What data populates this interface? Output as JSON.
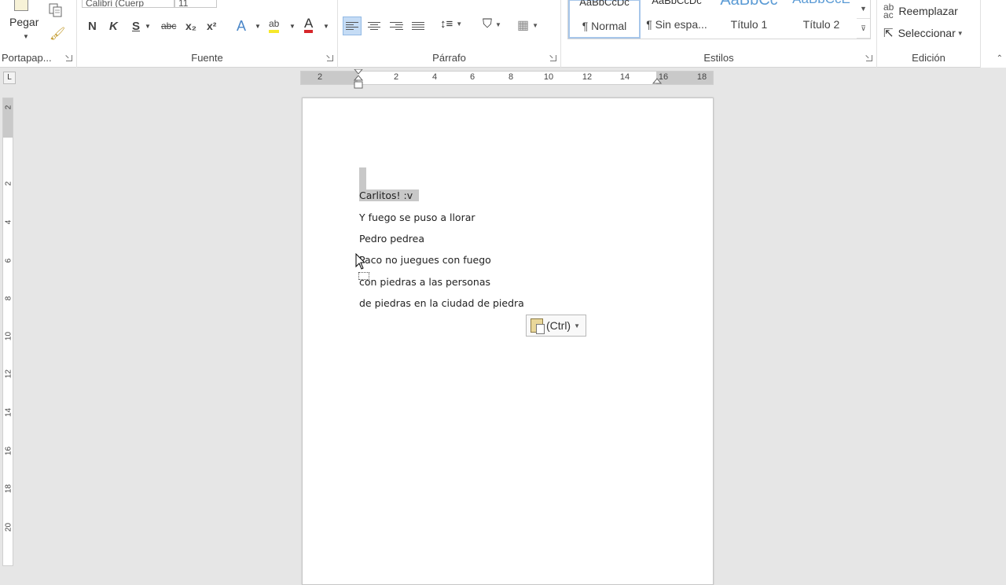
{
  "ribbon": {
    "clipboard": {
      "paste_label": "Pegar",
      "group_label": "Portapap..."
    },
    "font": {
      "font_name": "Calibri (Cuerp",
      "font_size": "11",
      "bold": "N",
      "italic": "K",
      "underline": "S",
      "strikethrough": "abc",
      "subscript": "x₂",
      "superscript": "x²",
      "group_label": "Fuente"
    },
    "paragraph": {
      "group_label": "Párrafo"
    },
    "styles": {
      "items": [
        {
          "sample": "AaBbCcDc",
          "name": "¶ Normal"
        },
        {
          "sample": "AaBbCcDc",
          "name": "¶ Sin espa..."
        },
        {
          "sample": "AaBbCc",
          "name": "Título 1"
        },
        {
          "sample": "AaBbCcE",
          "name": "Título 2"
        }
      ],
      "group_label": "Estilos"
    },
    "editing": {
      "replace_label": "Reemplazar",
      "select_label": "Seleccionar",
      "group_label": "Edición"
    }
  },
  "ruler": {
    "corner": "L",
    "h_labels": [
      "2",
      "2",
      "4",
      "6",
      "8",
      "10",
      "12",
      "14",
      "16",
      "18"
    ],
    "v_labels": [
      "2",
      "2",
      "4",
      "6",
      "8",
      "10",
      "12",
      "14",
      "16",
      "18",
      "20"
    ]
  },
  "document": {
    "lines": [
      "Carlitos! :v",
      "Y fuego se puso a llorar",
      "Pedro pedrea",
      "Paco no juegues con fuego",
      "con piedras a las personas",
      "de piedras en la ciudad de piedra"
    ]
  },
  "paste_options": {
    "label": "(Ctrl)"
  },
  "colors": {
    "highlight": "#f6e82b",
    "font_color": "#d6262a",
    "selection": "#c8c8c8",
    "heading_style": "#5b9bd5"
  }
}
